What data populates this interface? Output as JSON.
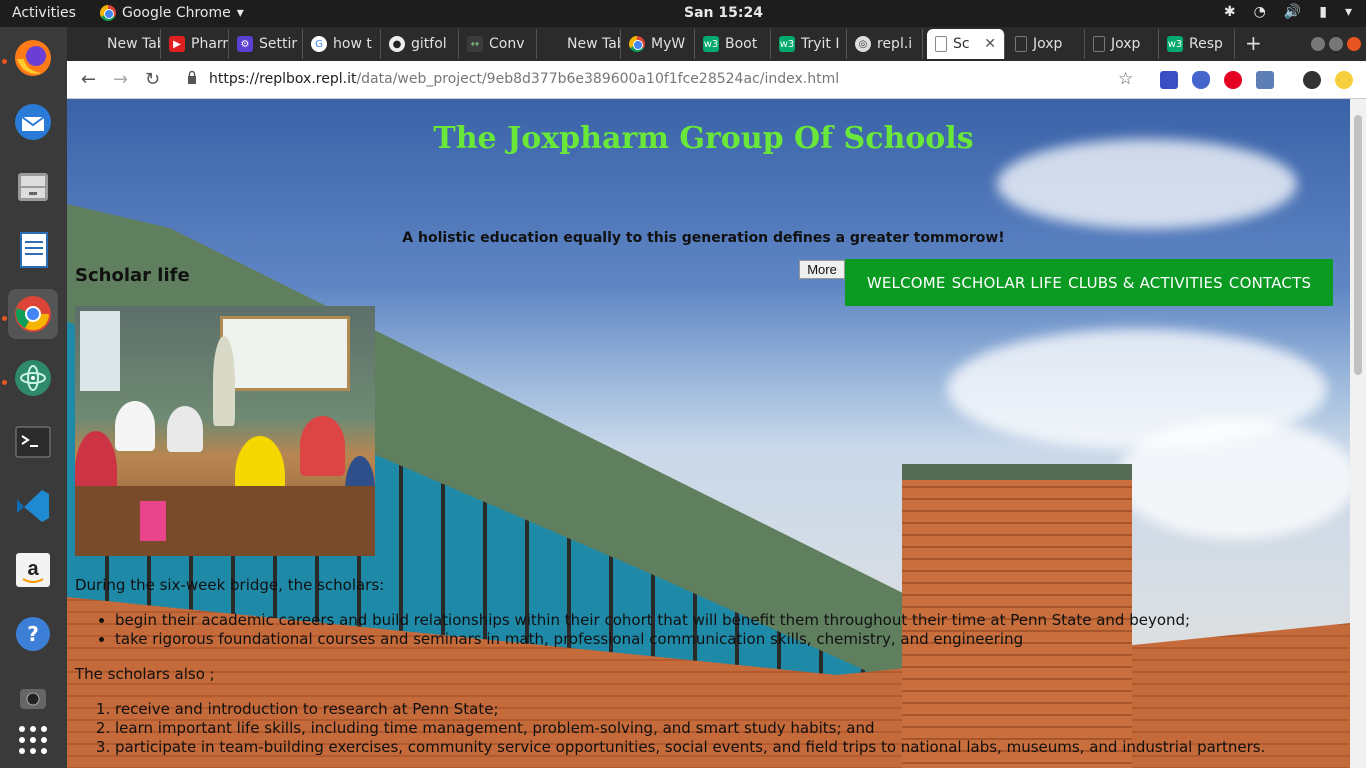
{
  "system": {
    "activities": "Activities",
    "app_name": "Google Chrome",
    "clock": "San 15:24"
  },
  "browser": {
    "tabs": [
      {
        "label": "New Tab",
        "icon": "blank-icon"
      },
      {
        "label": "Pharr",
        "icon": "youtube-icon"
      },
      {
        "label": "Settir",
        "icon": "settings-icon"
      },
      {
        "label": "how t",
        "icon": "google-icon"
      },
      {
        "label": "gitfol",
        "icon": "github-icon"
      },
      {
        "label": "Conv",
        "icon": "convert-icon"
      },
      {
        "label": "New Tab",
        "icon": "blank-icon"
      },
      {
        "label": "MyW",
        "icon": "chrome-icon"
      },
      {
        "label": "Boot",
        "icon": "w3-icon"
      },
      {
        "label": "Tryit I",
        "icon": "w3-icon"
      },
      {
        "label": "repl.i",
        "icon": "repl-icon"
      },
      {
        "label": "Sc",
        "icon": "page-icon"
      },
      {
        "label": "Joxp",
        "icon": "page-icon"
      },
      {
        "label": "Joxp",
        "icon": "page-icon"
      },
      {
        "label": "Resp",
        "icon": "w3-icon"
      }
    ],
    "url_host": "https://replbox.repl.it",
    "url_path": "/data/web_project/9eb8d377b6e389600a10f1fce28524ac/index.html"
  },
  "page": {
    "title": "The Joxpharm Group Of Schools",
    "tagline": "A holistic education equally to this generation defines a greater tommorow!",
    "section_title": "Scholar life",
    "more_button": "More",
    "nav": [
      "WELCOME",
      "SCHOLAR LIFE",
      "CLUBS & ACTIVITIES",
      "CONTACTS"
    ],
    "intro": "During the six-week bridge, the scholars:",
    "bullets": [
      "begin their academic careers and build relationships within their cohort that will benefit them throughout their time at Penn State and beyond;",
      "take rigorous foundational courses and seminars in math, professional communication skills, chemistry, and engineering"
    ],
    "also": "The scholars also ;",
    "numbered": [
      "receive and introduction to research at Penn State;",
      "learn important life skills, including time management, problem-solving, and smart study habits; and",
      "participate in team-building exercises, community service opportunities, social events, and field trips to national labs, museums, and industrial partners."
    ]
  },
  "colors": {
    "title_green": "#6ae83a",
    "nav_green": "#0b9a22"
  }
}
